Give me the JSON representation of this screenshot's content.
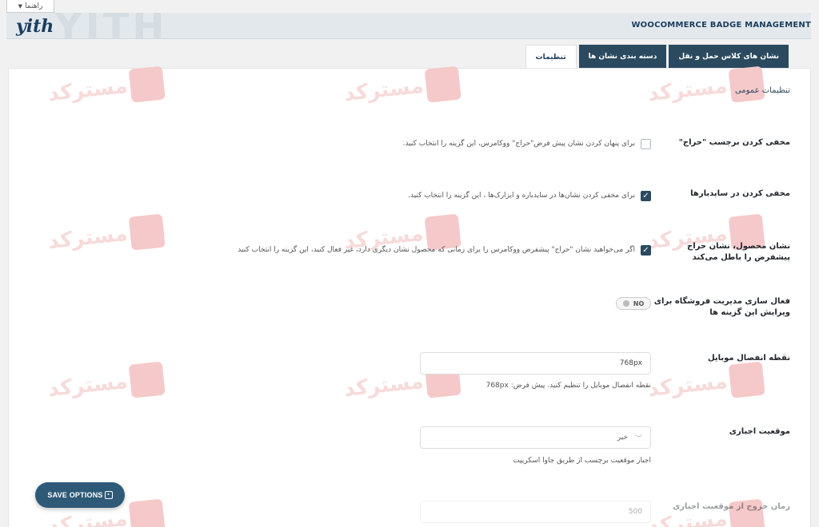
{
  "help_tab": {
    "label": "راهنما"
  },
  "header": {
    "logo": "yith",
    "title": "WOOCOMMERCE BADGE MANAGEMENT"
  },
  "tabs": [
    {
      "label": "تنظیمات",
      "active": true
    },
    {
      "label": "دسته بندی نشان ها",
      "active": false
    },
    {
      "label": "نشان های کلاس حمل و نقل",
      "active": false
    }
  ],
  "section_title": "تنظیمات عمومی",
  "settings": {
    "hide_sale": {
      "label": "مخفی کردن برچسب \"حراج\"",
      "desc": "برای پنهان کردن نشان پیش فرض\"حراج\" ووکامرس، این گزینه را انتخاب کنید.",
      "checked": false
    },
    "hide_sidebars": {
      "label": "مخفی کردن در سایدبارها",
      "desc": "برای مخفی کردن نشان‌ها در سایدباره و ابزارک‌ها ، این گزینه را انتخاب کنید.",
      "checked": true
    },
    "product_badge": {
      "label_line1": "نشان محصول، نشان حراج",
      "label_line2": "پیشفرض را باطل می‌کند",
      "desc": "اگر می‌خواهید نشان \"حراج\" پیشفرض ووکامرس را برای زمانی که محصول نشان دیگری دارد، غیر فعال کنید، این گزینه را انتخاب کنید",
      "checked": true
    },
    "shop_manager": {
      "label_line1": "فعال سازی مدیریت فروشگاه برای",
      "label_line2": "ویرایش این گزینه ها",
      "toggle": "NO"
    },
    "mobile_breakpoint": {
      "label": "نقطه انفصال موبایل",
      "value": "768px",
      "desc": "نقطه انفصال موبایل را تنظیم کنید. پیش فرض: 768px"
    },
    "force_position": {
      "label": "موقعیت اجباری",
      "value": "خیر",
      "desc": "اجبار موقعیت برچسب از طریق جاوا اسکریپت"
    },
    "force_timeout": {
      "label": "زمان خروج از موقعیت اجباری",
      "value": "500"
    }
  },
  "watermark": "مسترکد",
  "save_button": {
    "label": "SAVE OPTIONS"
  },
  "colors": {
    "accent": "#2b4a5f",
    "button": "#2e5a78",
    "topbar": "#e3e8ec"
  }
}
